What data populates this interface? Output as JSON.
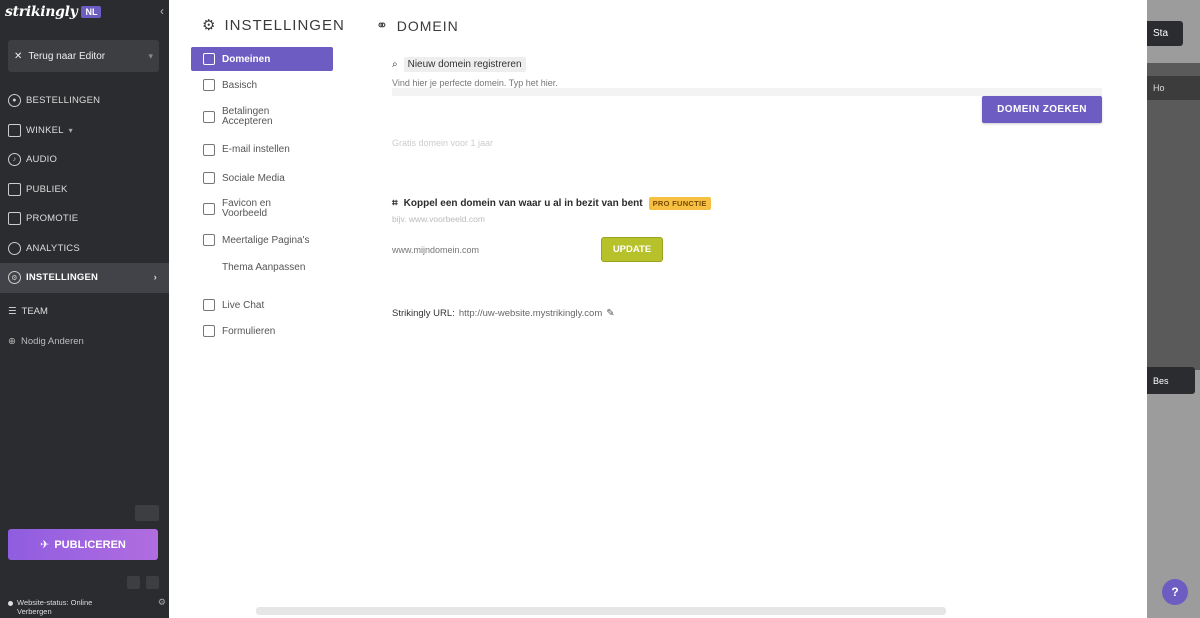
{
  "sidebar": {
    "brand": "strikingly",
    "brand_badge": "NL",
    "back_label": "Terug naar Editor",
    "nav": [
      {
        "label": "BESTELLINGEN",
        "icon": "orders-icon"
      },
      {
        "label": "WINKEL",
        "icon": "store-icon"
      },
      {
        "label": "AUDIO",
        "icon": "audio-icon"
      },
      {
        "label": "PUBLIEK",
        "icon": "audience-icon"
      },
      {
        "label": "PROMOTIE",
        "icon": "promotion-icon"
      },
      {
        "label": "ANALYTICS",
        "icon": "analytics-icon"
      },
      {
        "label": "INSTELLINGEN",
        "icon": "settings-icon"
      }
    ],
    "team_label": "TEAM",
    "invite_label": "Nodig Anderen",
    "publish_label": "PUBLICEREN",
    "status_line1": "Website-status: Online",
    "status_line2": "Verbergen"
  },
  "settings": {
    "title": "INSTELLINGEN",
    "items": [
      {
        "label": "Domeinen",
        "active": true
      },
      {
        "label": "Basisch"
      },
      {
        "label": "Betalingen Accepteren"
      },
      {
        "label": "E-mail instellen"
      },
      {
        "label": "Sociale Media"
      },
      {
        "label": "Favicon en Voorbeeld"
      },
      {
        "label": "Meertalige Pagina's"
      },
      {
        "label": "Thema Aanpassen"
      },
      {
        "label": "Live Chat"
      },
      {
        "label": "Formulieren"
      }
    ]
  },
  "domain": {
    "title": "DOMEIN",
    "search_label": "Nieuw domein registreren",
    "search_sub": "Vind hier je perfecte domein. Typ het hier.",
    "search_button": "DOMEIN ZOEKEN",
    "faint_line": "Gratis domein voor 1 jaar",
    "connect_title": "Koppel een domein van waar u al in bezit van bent",
    "premium_badge": "PRO FUNCTIE",
    "connect_sub": "bijv. www.voorbeeld.com",
    "domain_placeholder": "www.mijndomein.com",
    "connect_button": "UPDATE",
    "strikingly_url_label": "Strikingly URL:",
    "strikingly_url": "http://uw-website.mystrikingly.com"
  },
  "preview": {
    "top_button": "Sta",
    "dark_bar": "Ho",
    "bottom_button": "Bes",
    "help": "?"
  }
}
